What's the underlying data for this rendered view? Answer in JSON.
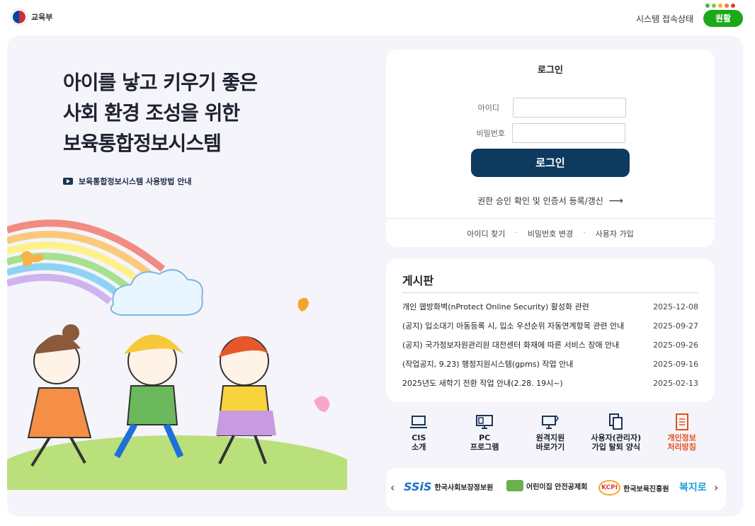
{
  "header": {
    "logo_text": "교육부",
    "status_label": "시스템 접속상태",
    "status_value": "원활",
    "status_dot_colors": [
      "#4caf50",
      "#8bc34a",
      "#ffb300",
      "#ff7043",
      "#e53935"
    ]
  },
  "hero": {
    "title_lines": [
      "아이를 낳고 키우기 좋은",
      "사회 환경 조성을 위한",
      "보육통합정보시스템"
    ],
    "guide_link": "보육통합정보시스템 사용방법 안내"
  },
  "login": {
    "title": "로그인",
    "id_label": "아이디",
    "pw_label": "비밀번호",
    "id_value": "",
    "pw_value": "",
    "button": "로그인",
    "cert_link": "권한 승인 확인 및 인증서 등록/갱신",
    "find_id": "아이디 찾기",
    "change_pw": "비밀번호 변경",
    "signup": "사용자 가입"
  },
  "board": {
    "title": "게시판",
    "items": [
      {
        "title": "개인 웹방화벽(nProtect Online Security) 활성화 관련",
        "date": "2025-12-08"
      },
      {
        "title": "(공지) 입소대기 아동등록 시, 입소 우선순위 자동연계항목 관련 안내",
        "date": "2025-09-27"
      },
      {
        "title": "(공지) 국가정보자원관리원 대전센터 화재에 따른 서비스 장애 안내",
        "date": "2025-09-26"
      },
      {
        "title": "(작업공지, 9.23) 행정지원시스템(gpms) 작업 안내",
        "date": "2025-09-16"
      },
      {
        "title": "2025년도 새학기 전환 작업 안내(2.28. 19시~)",
        "date": "2025-02-13"
      }
    ]
  },
  "quick_links": [
    {
      "label": "CIS\n소개",
      "icon": "laptop-icon"
    },
    {
      "label": "PC\n프로그램",
      "icon": "desktop-icon"
    },
    {
      "label": "원격지원\n바로가기",
      "icon": "remote-support-icon"
    },
    {
      "label": "사용자(관리자)\n가입 탈퇴 양식",
      "icon": "document-copy-icon"
    },
    {
      "label": "개인정보\n처리방침",
      "icon": "privacy-document-icon"
    }
  ],
  "partners": {
    "items": [
      {
        "mark": "SSiS",
        "name": "한국사회보장정보원"
      },
      {
        "mark": "",
        "name": "어린이집 안전공제회"
      },
      {
        "mark": "KCPI",
        "name": "한국보육진흥원"
      },
      {
        "mark": "복지로",
        "name": ""
      }
    ]
  },
  "colors": {
    "primary_button": "#0f3a5f",
    "status_green": "#1ba81b",
    "panel_bg": "#f4f4fa",
    "privacy_accent": "#e2531c"
  }
}
